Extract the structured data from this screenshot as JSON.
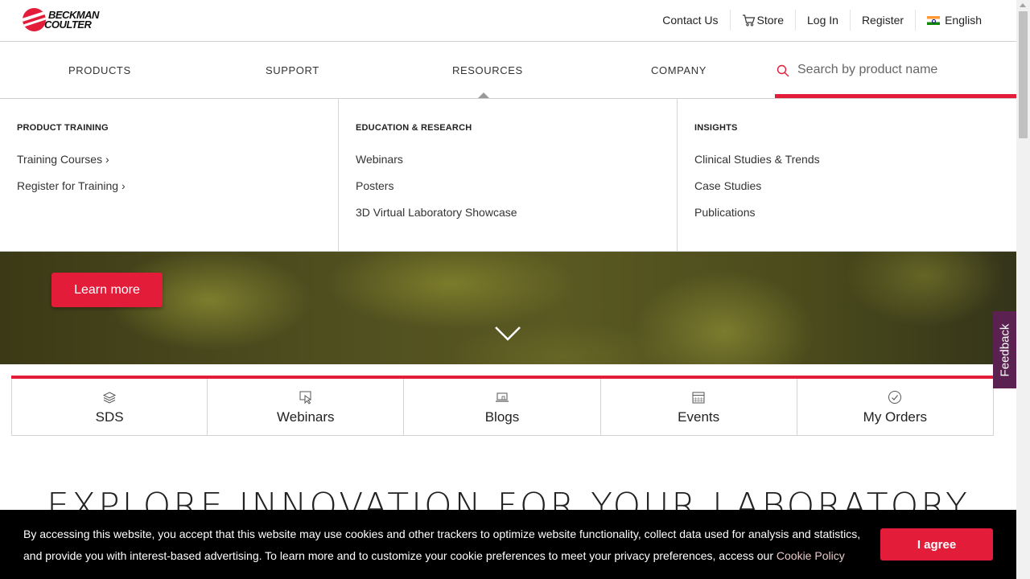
{
  "brand": {
    "line1": "BECKMAN",
    "line2": "COULTER"
  },
  "utility": {
    "contact": "Contact Us",
    "store": "Store",
    "login": "Log In",
    "register": "Register",
    "language": "English"
  },
  "nav": {
    "items": [
      "PRODUCTS",
      "SUPPORT",
      "RESOURCES",
      "COMPANY"
    ],
    "search_placeholder": "Search by product name"
  },
  "megamenu": {
    "columns": [
      {
        "heading": "PRODUCT TRAINING",
        "links": [
          "Training Courses ›",
          "Register for Training ›"
        ]
      },
      {
        "heading": "EDUCATION & RESEARCH",
        "links": [
          "Webinars",
          "Posters",
          "3D Virtual Laboratory Showcase"
        ]
      },
      {
        "heading": "INSIGHTS",
        "links": [
          "Clinical Studies & Trends",
          "Case Studies",
          "Publications"
        ]
      }
    ]
  },
  "hero": {
    "button": "Learn more"
  },
  "feedback": "Feedback",
  "quicklinks": [
    {
      "label": "SDS",
      "icon": "layers-icon"
    },
    {
      "label": "Webinars",
      "icon": "cursor-screen-icon"
    },
    {
      "label": "Blogs",
      "icon": "laptop-icon"
    },
    {
      "label": "Events",
      "icon": "calendar-icon"
    },
    {
      "label": "My Orders",
      "icon": "check-circle-icon"
    }
  ],
  "section_title": "EXPLORE INNOVATION FOR YOUR LABORATORY",
  "cookie": {
    "text": "By accessing this website, you accept that this website may use cookies and other trackers to optimize website functionality, collect data used for analysis and statistics, and provide you with interest-based advertising. To learn more and to customize your cookie preferences to meet your privacy preferences, access our ",
    "link": "Cookie Policy",
    "button": "I agree"
  },
  "colors": {
    "brand_red": "#e31c39",
    "feedback_purple": "#5b2251"
  }
}
